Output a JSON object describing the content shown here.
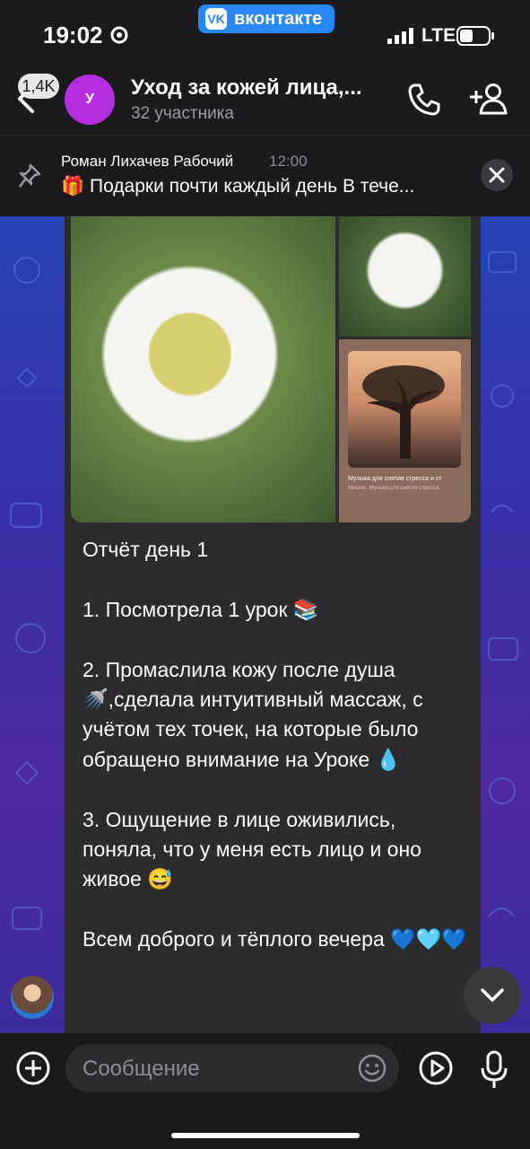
{
  "status_bar": {
    "time": "19:02",
    "carrier_badge": "вконтакте",
    "carrier_logo": "VK",
    "network": "LTE"
  },
  "header": {
    "back_badge": "1,4K",
    "avatar_letter": "У",
    "title": "Уход за кожей лица,...",
    "subtitle": "32 участника"
  },
  "pinned": {
    "author": "Роман Лихачев Рабочий",
    "time": "12:00",
    "text": "🎁 Подарки почти каждый день В тече..."
  },
  "message": {
    "music_title": "Музыка для снятия стресса и ст",
    "music_subtitle": "Misonix. Музыка для снятия стресса",
    "text": "Отчёт день 1\n\n1. Посмотрела 1 урок 📚\n\n2. Промаслила кожу после душа 🚿,сделала интуитивный массаж, с учётом тех точек, на которые было обращено внимание на Уроке 💧\n\n3. Ощущение в лице оживились, поняла, что у меня есть лицо и оно живое 😅\n\nВсем доброго и тёплого вечера 💙🩵💙"
  },
  "input": {
    "placeholder": "Сообщение"
  },
  "colors": {
    "accent": "#2787f5",
    "chat_avatar": "#b52fe0",
    "bubble": "#2c2c2e",
    "bar": "#1b1b1d"
  },
  "icons": [
    "settings-gear-icon",
    "signal-icon",
    "battery-icon",
    "back-chevron-icon",
    "phone-icon",
    "add-user-icon",
    "pin-icon",
    "close-icon",
    "chevron-down-icon",
    "plus-icon",
    "emoji-icon",
    "play-icon",
    "microphone-icon"
  ]
}
